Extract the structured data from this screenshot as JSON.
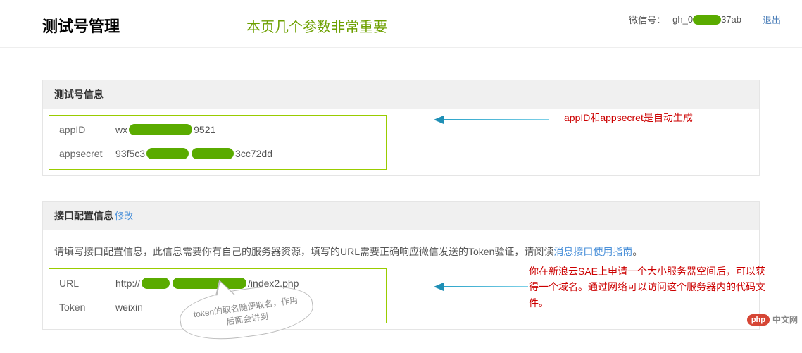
{
  "header": {
    "title": "测试号管理",
    "notice": "本页几个参数非常重要",
    "wechat_label": "微信号：",
    "wechat_id_prefix": "gh_0",
    "wechat_id_suffix": "37ab",
    "logout": "退出"
  },
  "section_info": {
    "title": "测试号信息",
    "appid_label": "appID",
    "appid_prefix": "wx",
    "appid_suffix": "9521",
    "appsecret_label": "appsecret",
    "appsecret_prefix": "93f5c3",
    "appsecret_suffix": "3cc72dd"
  },
  "annotation1": "appID和appsecret是自动生成",
  "section_api": {
    "title": "接口配置信息",
    "modify": "修改",
    "intro_pre": "请填写接口配置信息，此信息需要你有自己的服务器资源，填写的URL需要正确响应微信发送的Token验证，请阅读",
    "guide": "消息接口使用指南",
    "intro_suf": "。",
    "url_label": "URL",
    "url_prefix": "http://",
    "url_suffix": "/index2.php",
    "token_label": "Token",
    "token_value": "weixin"
  },
  "annotation2": "你在新浪云SAE上申请一个大小服务器空间后，可以获得一个域名。通过网络可以访问这个服务器内的代码文件。",
  "bubble_text": "token的取名随便取名，作用后面会讲到",
  "watermark": {
    "badge": "php",
    "text": "中文网"
  }
}
